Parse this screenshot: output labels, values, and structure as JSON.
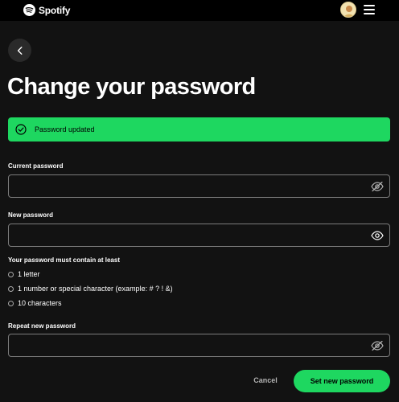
{
  "header": {
    "brand": "Spotify",
    "avatar_icon": "user-avatar",
    "menu_icon": "hamburger-menu-icon"
  },
  "page": {
    "title": "Change your password"
  },
  "banner": {
    "text": "Password updated",
    "color": "#1ed760",
    "icon": "check-circle-icon"
  },
  "form": {
    "current_password": {
      "label": "Current password",
      "value": "",
      "visibility_icon": "eye-off-icon"
    },
    "new_password": {
      "label": "New password",
      "value": "",
      "visibility_icon": "eye-icon"
    },
    "requirements": {
      "heading": "Your password must contain at least",
      "items": [
        "1 letter",
        "1 number or special character (example: # ? ! &)",
        "10 characters"
      ]
    },
    "repeat_password": {
      "label": "Repeat new password",
      "value": "",
      "visibility_icon": "eye-off-icon"
    }
  },
  "actions": {
    "cancel_label": "Cancel",
    "submit_label": "Set new password"
  },
  "colors": {
    "background": "#121212",
    "topbar": "#000000",
    "accent": "#1ed760"
  }
}
